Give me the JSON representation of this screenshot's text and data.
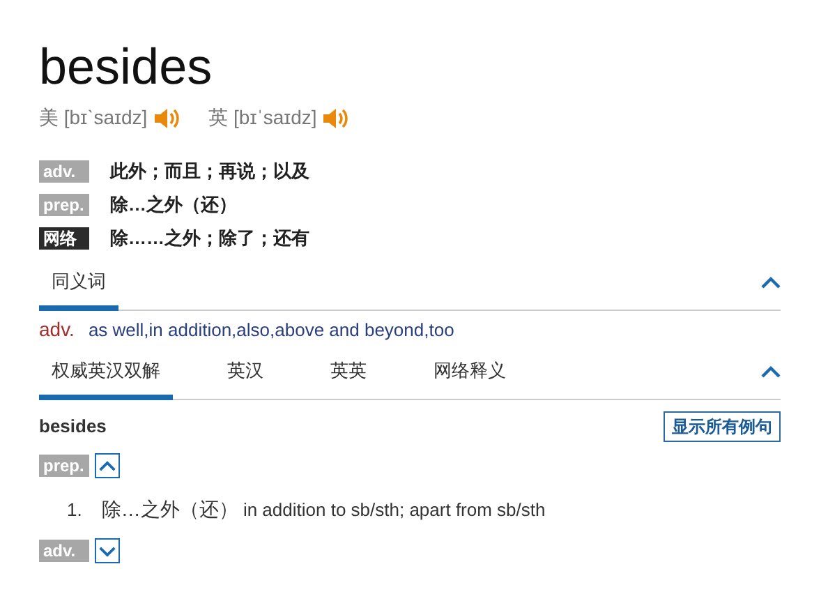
{
  "headword": "besides",
  "pronunciations": [
    {
      "label": "美",
      "phonetic": "[bɪˋsaɪdz]"
    },
    {
      "label": "英",
      "phonetic": "[bɪˈsaɪdz]"
    }
  ],
  "definitions": [
    {
      "kind": "pos",
      "tag": "adv.",
      "text": "此外；而且；再说；以及"
    },
    {
      "kind": "pos",
      "tag": "prep.",
      "text": "除…之外（还）"
    },
    {
      "kind": "web",
      "tag": "网络",
      "text": "除……之外；除了；还有"
    }
  ],
  "synonyms": {
    "tabs": [
      {
        "label": "同义词",
        "selected": true
      }
    ],
    "expanded": true,
    "entries": [
      {
        "pos": "adv.",
        "words": "as well,in addition,also,above and beyond,too"
      }
    ]
  },
  "dictionary": {
    "tabs": [
      {
        "label": "权威英汉双解",
        "selected": true
      },
      {
        "label": "英汉",
        "selected": false
      },
      {
        "label": "英英",
        "selected": false
      },
      {
        "label": "网络释义",
        "selected": false
      }
    ],
    "expanded": true,
    "word": "besides",
    "button": "显示所有例句",
    "groups": [
      {
        "pos": "prep.",
        "expanded": true,
        "senses": [
          {
            "number": "1.",
            "chinese": "除…之外（还）",
            "english": "in addition to sb/sth; apart from sb/sth"
          }
        ]
      },
      {
        "pos": "adv.",
        "expanded": false
      }
    ]
  }
}
